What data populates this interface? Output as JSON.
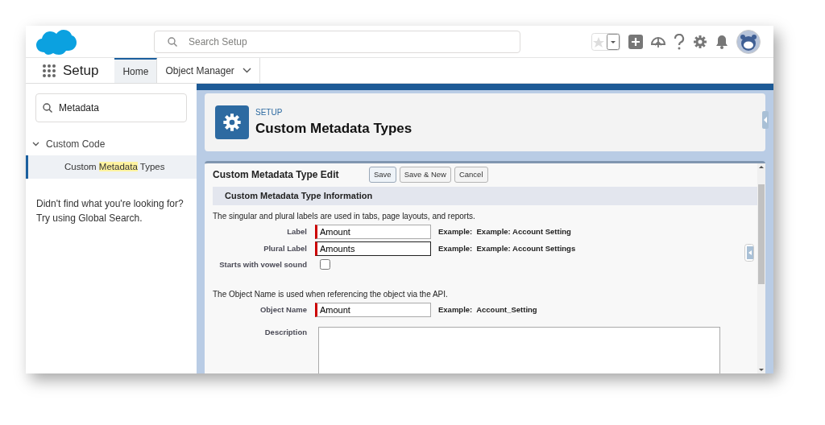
{
  "header": {
    "search_placeholder": "Search Setup"
  },
  "nav": {
    "app_name": "Setup",
    "tabs": [
      {
        "label": "Home",
        "selected": true,
        "has_menu": false
      },
      {
        "label": "Object Manager",
        "selected": false,
        "has_menu": true
      }
    ]
  },
  "sidebar": {
    "search_value": "Metadata",
    "groups": [
      {
        "label": "Custom Code",
        "expanded": true,
        "children": [
          {
            "parts": [
              {
                "text": "Custom ",
                "highlight": false
              },
              {
                "text": "Metadata",
                "highlight": true
              },
              {
                "text": " Types",
                "highlight": false
              }
            ],
            "selected": true
          }
        ]
      }
    ],
    "help_lines": [
      "Didn't find what you're looking for?",
      "Try using Global Search."
    ]
  },
  "page_header": {
    "eyebrow": "SETUP",
    "title": "Custom Metadata Types"
  },
  "form": {
    "title": "Custom Metadata Type Edit",
    "buttons": [
      {
        "label": "Save",
        "selected": true
      },
      {
        "label": "Save & New",
        "selected": false
      },
      {
        "label": "Cancel",
        "selected": false
      }
    ],
    "section_title": "Custom Metadata Type Information",
    "rows": [
      {
        "kind": "note",
        "text": "The singular and plural labels are used in tabs, page layouts, and reports."
      },
      {
        "kind": "text",
        "label": "Label",
        "value": "Amount",
        "required": true,
        "focused": false,
        "example": "Example:  Example: Account Setting"
      },
      {
        "kind": "text",
        "label": "Plural Label",
        "value": "Amounts",
        "required": true,
        "focused": true,
        "example": "Example:  Example: Account Settings"
      },
      {
        "kind": "checkbox",
        "label": "Starts with vowel sound",
        "checked": false
      },
      {
        "kind": "note",
        "text": "The Object Name is used when referencing the object via the API."
      },
      {
        "kind": "text",
        "label": "Object Name",
        "value": "Amount",
        "required": true,
        "focused": false,
        "example": "Example:  Account_Setting"
      },
      {
        "kind": "textarea",
        "label": "Description"
      }
    ]
  }
}
